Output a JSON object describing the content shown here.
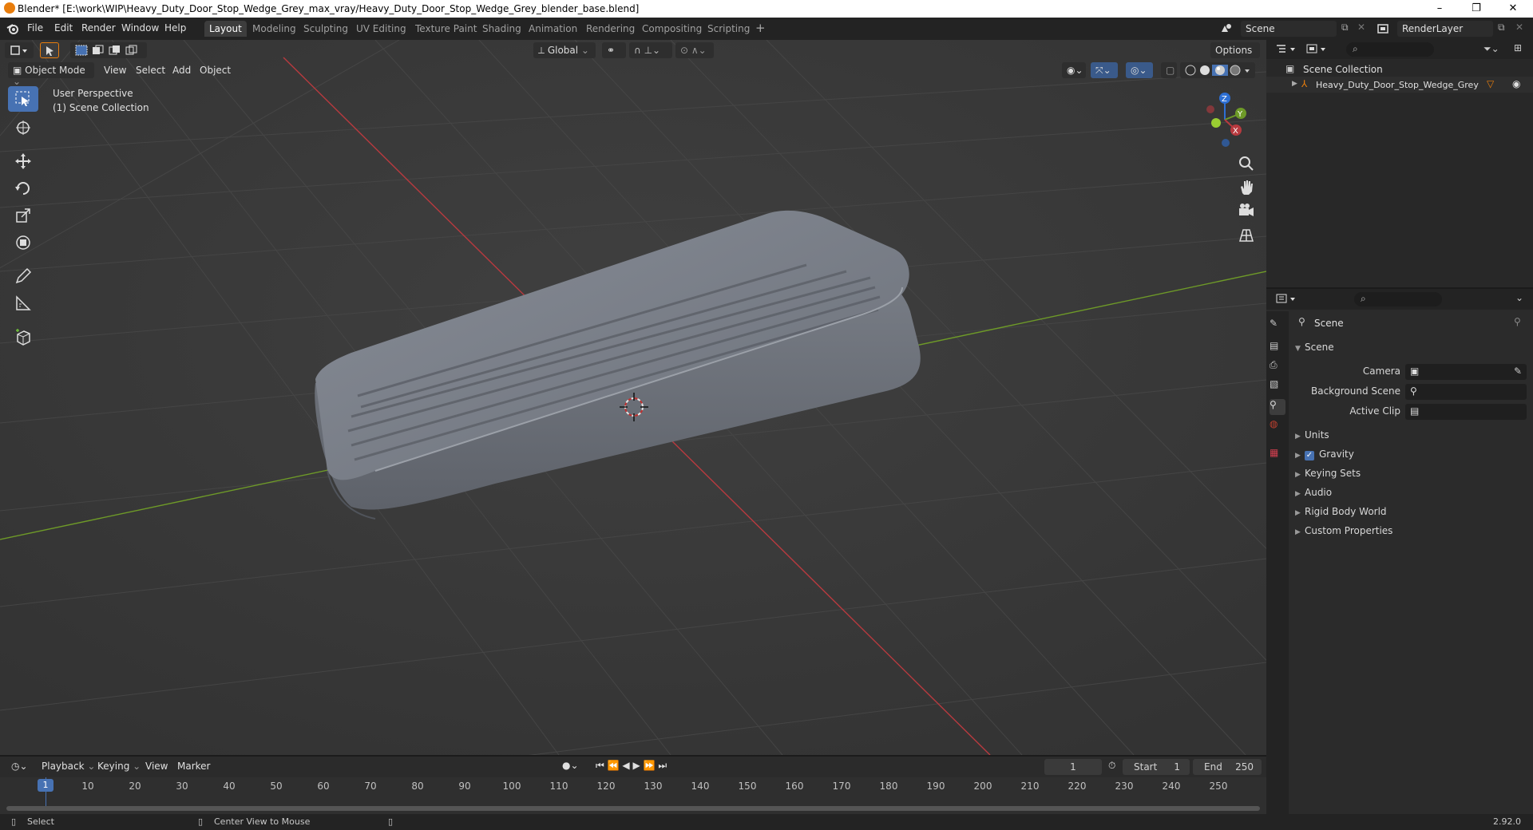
{
  "window": {
    "title": "Blender* [E:\\work\\WIP\\Heavy_Duty_Door_Stop_Wedge_Grey_max_vray/Heavy_Duty_Door_Stop_Wedge_Grey_blender_base.blend]",
    "minimize": "–",
    "maximize": "❐",
    "close": "✕"
  },
  "menu": [
    "File",
    "Edit",
    "Render",
    "Window",
    "Help"
  ],
  "workspaces": [
    "Layout",
    "Modeling",
    "Sculpting",
    "UV Editing",
    "Texture Paint",
    "Shading",
    "Animation",
    "Rendering",
    "Compositing",
    "Scripting"
  ],
  "scene_field": "Scene",
  "renderlayer_field": "RenderLayer",
  "viewport": {
    "mode": "Object Mode",
    "menus": [
      "View",
      "Select",
      "Add",
      "Object"
    ],
    "orientation": "Global",
    "options": "Options",
    "overlay_line1": "User Perspective",
    "overlay_line2": "(1) Scene Collection"
  },
  "outliner": {
    "root": "Scene Collection",
    "items": [
      {
        "label": "Heavy_Duty_Door_Stop_Wedge_Grey"
      }
    ]
  },
  "properties": {
    "context": "Scene",
    "panel": "Scene",
    "rows": [
      {
        "label": "Camera"
      },
      {
        "label": "Background Scene"
      },
      {
        "label": "Active Clip"
      }
    ],
    "sections": [
      "Units",
      "Gravity",
      "Keying Sets",
      "Audio",
      "Rigid Body World",
      "Custom Properties"
    ],
    "gravity_checked": true
  },
  "timeline": {
    "menus": [
      "Playback",
      "Keying",
      "View",
      "Marker"
    ],
    "current_frame": "1",
    "start_label": "Start",
    "start_value": "1",
    "end_label": "End",
    "end_value": "250",
    "ticks": [
      "10",
      "20",
      "30",
      "40",
      "50",
      "60",
      "70",
      "80",
      "90",
      "100",
      "110",
      "120",
      "130",
      "140",
      "150",
      "160",
      "170",
      "180",
      "190",
      "200",
      "210",
      "220",
      "230",
      "240",
      "250"
    ],
    "cursor": "1"
  },
  "status": {
    "select": "Select",
    "center": "Center View to Mouse",
    "version": "2.92.0"
  },
  "gizmo": {
    "x": "X",
    "y": "Y",
    "z": "Z"
  },
  "colors": {
    "accent": "#4772b3",
    "x_axis": "#b83a3f",
    "y_axis": "#6e9a28",
    "z_axis": "#2d6fd4",
    "object_orange": "#e87d0d"
  }
}
